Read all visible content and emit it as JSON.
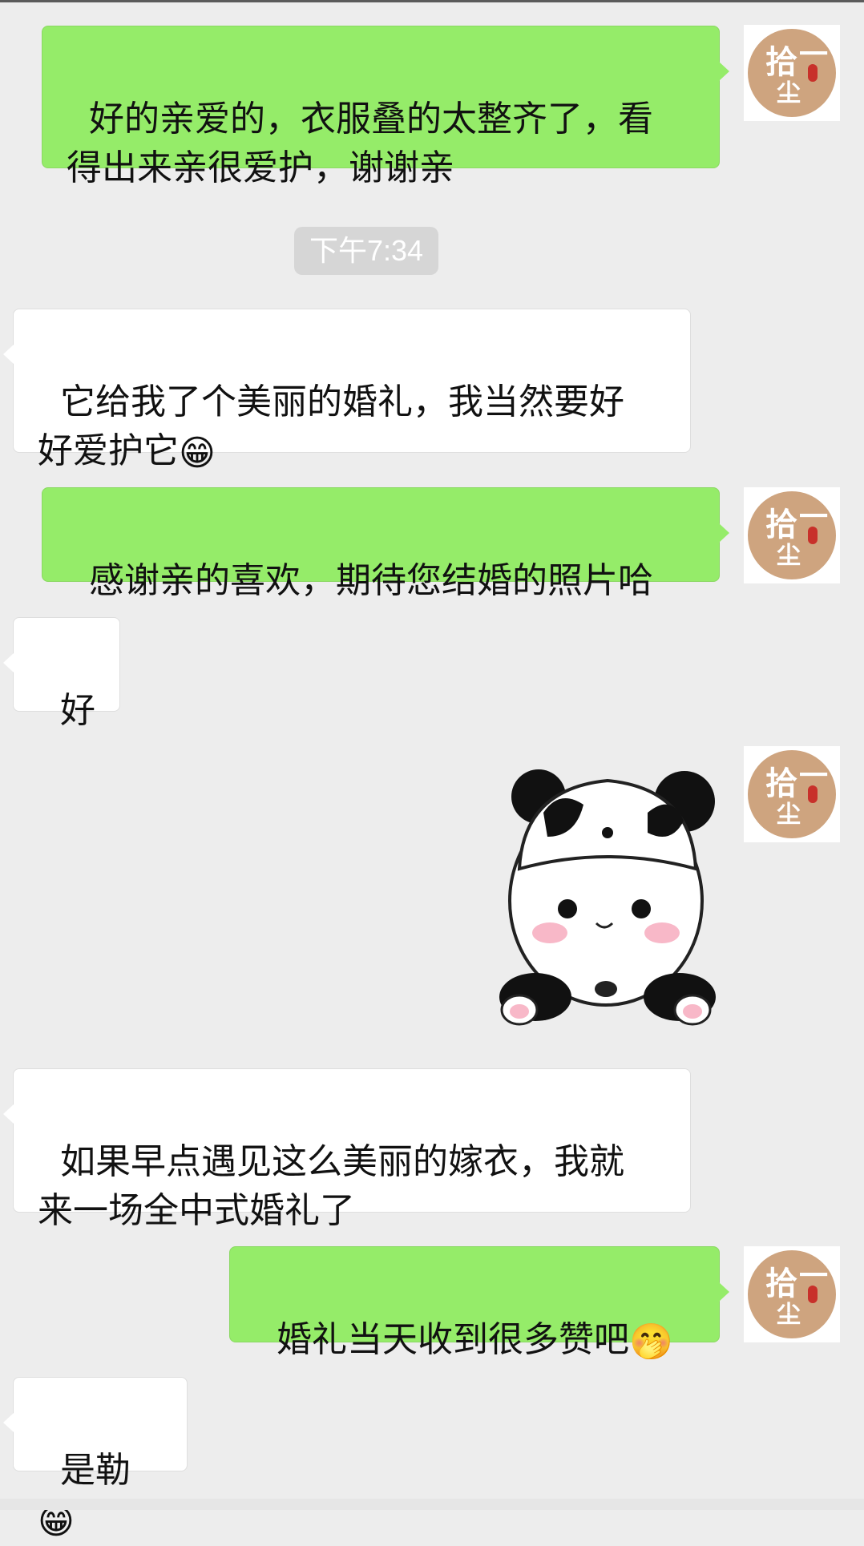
{
  "messages": [
    {
      "side": "me",
      "text": "好的亲爱的，衣服叠的太整齐了，看\n得出来亲很爱护，谢谢亲"
    },
    {
      "timestamp": "下午7:34"
    },
    {
      "side": "them",
      "text": "它给我了个美丽的婚礼，我当然要好\n好爱护它",
      "emoji": "😁"
    },
    {
      "side": "me",
      "text": "感谢亲的喜欢，期待您结婚的照片哈"
    },
    {
      "side": "them",
      "text": "好"
    },
    {
      "side": "me",
      "sticker": "panda-sticker"
    },
    {
      "side": "them",
      "text": "如果早点遇见这么美丽的嫁衣，我就\n来一场全中式婚礼了"
    },
    {
      "side": "me",
      "text": "婚礼当天收到很多赞吧",
      "emoji": "🤭"
    },
    {
      "side": "them",
      "text": "是勒",
      "emoji": "😁"
    }
  ],
  "avatar": {
    "icon": "shop-logo-avatar",
    "glyph_main": "拾",
    "glyph_second": "一",
    "glyph_third": "尘",
    "bg_color": "#cea47f",
    "seal_color": "#c8302a"
  },
  "colors": {
    "background": "#ededed",
    "me_bubble": "#95ec69",
    "them_bubble": "#ffffff",
    "timestamp_bg": "#d6d6d6"
  }
}
